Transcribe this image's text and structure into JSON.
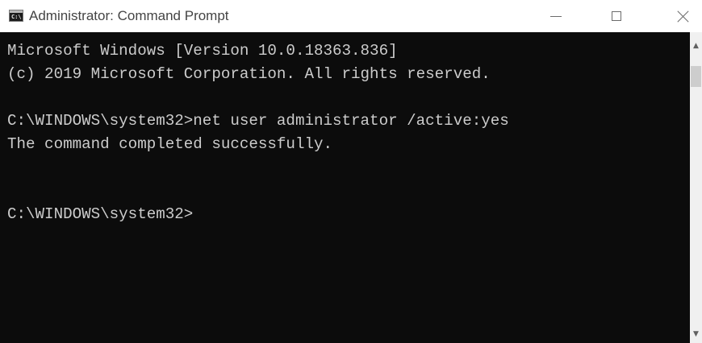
{
  "window": {
    "title": "Administrator: Command Prompt",
    "icon_glyph": "C:\\"
  },
  "console": {
    "lines": [
      "Microsoft Windows [Version 10.0.18363.836]",
      "(c) 2019 Microsoft Corporation. All rights reserved.",
      "",
      "C:\\WINDOWS\\system32>net user administrator /active:yes",
      "The command completed successfully.",
      "",
      "",
      "C:\\WINDOWS\\system32>"
    ]
  },
  "colors": {
    "console_bg": "#0c0c0c",
    "console_fg": "#cccccc",
    "titlebar_bg": "#ffffff"
  }
}
